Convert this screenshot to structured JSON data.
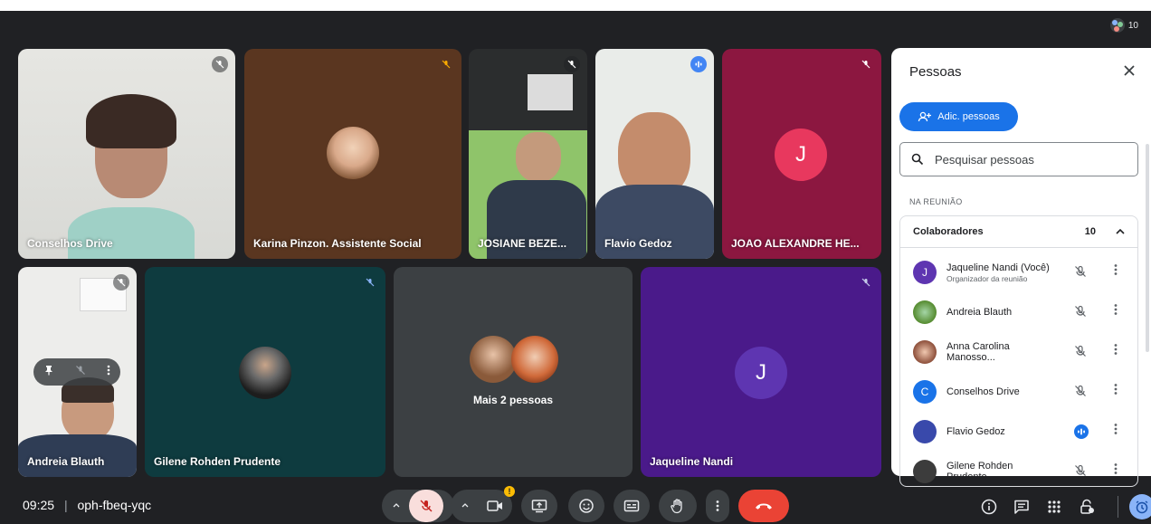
{
  "participants_count": "10",
  "tiles": {
    "conselhos": {
      "name": "Conselhos Drive"
    },
    "karina": {
      "name": "Karina Pinzon. Assistente Social"
    },
    "josiane": {
      "name": "JOSIANE BEZE..."
    },
    "flavio": {
      "name": "Flavio Gedoz"
    },
    "joao": {
      "name": "JOAO ALEXANDRE HE...",
      "initial": "J"
    },
    "andreia": {
      "name": "Andreia Blauth"
    },
    "gilene": {
      "name": "Gilene Rohden Prudente"
    },
    "mais": {
      "name": "Mais 2 pessoas"
    },
    "jaqueline": {
      "name": "Jaqueline Nandi",
      "initial": "J"
    }
  },
  "panel": {
    "title": "Pessoas",
    "add_label": "Adic. pessoas",
    "search_placeholder": "Pesquisar pessoas",
    "section_label": "NA REUNIÃO",
    "group_label": "Colaboradores",
    "group_count": "10",
    "people": [
      {
        "name": "Jaqueline Nandi (Você)",
        "subtitle": "Organizador da reunião",
        "initial": "J",
        "color": "#5e35b1"
      },
      {
        "name": "Andreia Blauth",
        "subtitle": "",
        "initial": "",
        "color": "#558b2f"
      },
      {
        "name": "Anna Carolina Manosso...",
        "subtitle": "",
        "initial": "",
        "color": "#8d4f3a"
      },
      {
        "name": "Conselhos Drive",
        "subtitle": "",
        "initial": "C",
        "color": "#1a73e8"
      },
      {
        "name": "Flavio Gedoz",
        "subtitle": "",
        "initial": "",
        "color": "#3949ab"
      },
      {
        "name": "Gilene Rohden Prudente",
        "subtitle": "",
        "initial": "",
        "color": "#3c3c3c"
      }
    ]
  },
  "bottom": {
    "time": "09:25",
    "separator": "|",
    "meeting_code": "oph-fbeq-yqc",
    "camera_warning": "!"
  },
  "colors": {
    "accent": "#1a73e8",
    "end_call": "#ea4335",
    "joao_bg": "#8c1740",
    "jaqueline_bg": "#4a1a8a"
  }
}
